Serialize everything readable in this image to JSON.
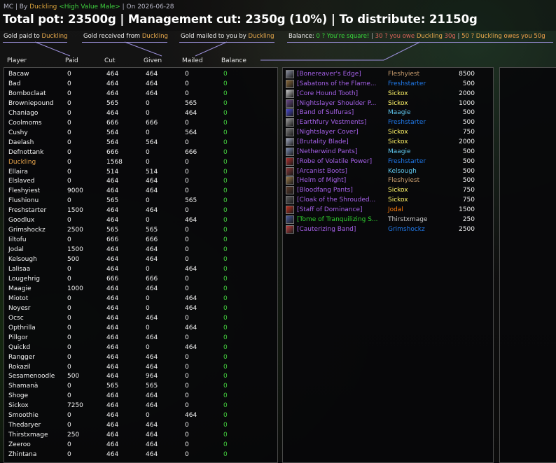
{
  "colors": {
    "gold": "#e3a24b",
    "green": "#45d43f",
    "epic_purple": "#a560e8",
    "uncommon_green": "#2fd02f",
    "legend_line": "#9a8fd8",
    "class_warrior": "#c69b6d",
    "class_shaman": "#1f78e8",
    "class_rogue": "#fff468",
    "class_mage": "#5fc7ee",
    "class_druid": "#ff7d0a"
  },
  "header": {
    "sub_prefix": "MC | By ",
    "sub_author": "Duckling",
    "sub_guild": "<High Value Male>",
    "sub_date": " | On 2026-06-28",
    "title": "Total pot: 23500g | Management cut: 2350g (10%) | To distribute: 21150g"
  },
  "legend": {
    "paid_label": "Gold paid to ",
    "paid_name": "Duckling",
    "received_label": "Gold received from ",
    "received_name": "Duckling",
    "mailed_label": "Gold mailed to you by ",
    "mailed_name": "Duckling",
    "balance_label": "Balance: ",
    "square": "0 ? You're square!",
    "sep1": " | ",
    "owe_prefix": "30 ? you owe ",
    "owe_name": "Duckling",
    "owe_suffix": " 30g",
    "sep2": " | ",
    "owed_prefix": "50 ? ",
    "owed_name": "Duckling",
    "owed_suffix": " owes you 50g"
  },
  "columns": {
    "player": "Player",
    "paid": "Paid",
    "cut": "Cut",
    "given": "Given",
    "mailed": "Mailed",
    "balance": "Balance"
  },
  "players": [
    {
      "name": "Bacaw",
      "paid": "0",
      "cut": "464",
      "given": "464",
      "mailed": "0",
      "balance": "0"
    },
    {
      "name": "Bad",
      "paid": "0",
      "cut": "464",
      "given": "464",
      "mailed": "0",
      "balance": "0"
    },
    {
      "name": "Bomboclaat",
      "paid": "0",
      "cut": "464",
      "given": "464",
      "mailed": "0",
      "balance": "0"
    },
    {
      "name": "Browniepound",
      "paid": "0",
      "cut": "565",
      "given": "0",
      "mailed": "565",
      "balance": "0"
    },
    {
      "name": "Chaniago",
      "paid": "0",
      "cut": "464",
      "given": "0",
      "mailed": "464",
      "balance": "0"
    },
    {
      "name": "Coolmoms",
      "paid": "0",
      "cut": "666",
      "given": "666",
      "mailed": "0",
      "balance": "0"
    },
    {
      "name": "Cushy",
      "paid": "0",
      "cut": "564",
      "given": "0",
      "mailed": "564",
      "balance": "0"
    },
    {
      "name": "Daelash",
      "paid": "0",
      "cut": "564",
      "given": "564",
      "mailed": "0",
      "balance": "0"
    },
    {
      "name": "Defnottank",
      "paid": "0",
      "cut": "666",
      "given": "0",
      "mailed": "666",
      "balance": "0"
    },
    {
      "name": "Duckling",
      "paid": "0",
      "cut": "1568",
      "given": "0",
      "mailed": "0",
      "balance": "0",
      "self": true
    },
    {
      "name": "Ellaira",
      "paid": "0",
      "cut": "514",
      "given": "514",
      "mailed": "0",
      "balance": "0"
    },
    {
      "name": "Elslaved",
      "paid": "0",
      "cut": "464",
      "given": "464",
      "mailed": "0",
      "balance": "0"
    },
    {
      "name": "Fleshyiest",
      "paid": "9000",
      "cut": "464",
      "given": "464",
      "mailed": "0",
      "balance": "0"
    },
    {
      "name": "Flushionu",
      "paid": "0",
      "cut": "565",
      "given": "0",
      "mailed": "565",
      "balance": "0"
    },
    {
      "name": "Freshstarter",
      "paid": "1500",
      "cut": "464",
      "given": "464",
      "mailed": "0",
      "balance": "0"
    },
    {
      "name": "Goodlux",
      "paid": "0",
      "cut": "464",
      "given": "0",
      "mailed": "464",
      "balance": "0"
    },
    {
      "name": "Grimshockz",
      "paid": "2500",
      "cut": "565",
      "given": "565",
      "mailed": "0",
      "balance": "0"
    },
    {
      "name": "Iiltofu",
      "paid": "0",
      "cut": "666",
      "given": "666",
      "mailed": "0",
      "balance": "0"
    },
    {
      "name": "Jodal",
      "paid": "1500",
      "cut": "464",
      "given": "464",
      "mailed": "0",
      "balance": "0"
    },
    {
      "name": "Kelsough",
      "paid": "500",
      "cut": "464",
      "given": "464",
      "mailed": "0",
      "balance": "0"
    },
    {
      "name": "Lalisaa",
      "paid": "0",
      "cut": "464",
      "given": "0",
      "mailed": "464",
      "balance": "0"
    },
    {
      "name": "Lougehrig",
      "paid": "0",
      "cut": "666",
      "given": "666",
      "mailed": "0",
      "balance": "0"
    },
    {
      "name": "Maagie",
      "paid": "1000",
      "cut": "464",
      "given": "464",
      "mailed": "0",
      "balance": "0"
    },
    {
      "name": "Miotot",
      "paid": "0",
      "cut": "464",
      "given": "0",
      "mailed": "464",
      "balance": "0"
    },
    {
      "name": "Noyesr",
      "paid": "0",
      "cut": "464",
      "given": "0",
      "mailed": "464",
      "balance": "0"
    },
    {
      "name": "Ocsc",
      "paid": "0",
      "cut": "464",
      "given": "464",
      "mailed": "0",
      "balance": "0"
    },
    {
      "name": "Opthrilla",
      "paid": "0",
      "cut": "464",
      "given": "0",
      "mailed": "464",
      "balance": "0"
    },
    {
      "name": "Pillgor",
      "paid": "0",
      "cut": "464",
      "given": "464",
      "mailed": "0",
      "balance": "0"
    },
    {
      "name": "Quickd",
      "paid": "0",
      "cut": "464",
      "given": "0",
      "mailed": "464",
      "balance": "0"
    },
    {
      "name": "Rangger",
      "paid": "0",
      "cut": "464",
      "given": "464",
      "mailed": "0",
      "balance": "0"
    },
    {
      "name": "Rokazil",
      "paid": "0",
      "cut": "464",
      "given": "464",
      "mailed": "0",
      "balance": "0"
    },
    {
      "name": "Sesamenoodle",
      "paid": "500",
      "cut": "464",
      "given": "964",
      "mailed": "0",
      "balance": "0"
    },
    {
      "name": "Shamanà",
      "paid": "0",
      "cut": "565",
      "given": "565",
      "mailed": "0",
      "balance": "0"
    },
    {
      "name": "Shoge",
      "paid": "0",
      "cut": "464",
      "given": "464",
      "mailed": "0",
      "balance": "0"
    },
    {
      "name": "Sickox",
      "paid": "7250",
      "cut": "464",
      "given": "464",
      "mailed": "0",
      "balance": "0"
    },
    {
      "name": "Smoothie",
      "paid": "0",
      "cut": "464",
      "given": "0",
      "mailed": "464",
      "balance": "0"
    },
    {
      "name": "Thedaryer",
      "paid": "0",
      "cut": "464",
      "given": "464",
      "mailed": "0",
      "balance": "0"
    },
    {
      "name": "Thirstxmage",
      "paid": "250",
      "cut": "464",
      "given": "464",
      "mailed": "0",
      "balance": "0"
    },
    {
      "name": "Zeeroo",
      "paid": "0",
      "cut": "464",
      "given": "464",
      "mailed": "0",
      "balance": "0"
    },
    {
      "name": "Zhintana",
      "paid": "0",
      "cut": "464",
      "given": "464",
      "mailed": "0",
      "balance": "0"
    }
  ],
  "items": [
    {
      "name": "[Bonereaver's Edge]",
      "winner": "Fleshyiest",
      "winner_color": "#c69b6d",
      "price": "8500",
      "icon": "sword-icon",
      "icon_color": "#8a8fa0",
      "quality": "epic"
    },
    {
      "name": "[Sabatons of the Flame...",
      "winner": "Freshstarter",
      "winner_color": "#1f78e8",
      "price": "500",
      "icon": "boots-icon",
      "icon_color": "#8b6a3a",
      "quality": "epic"
    },
    {
      "name": "[Core Hound Tooth]",
      "winner": "Sickox",
      "winner_color": "#fff468",
      "price": "2000",
      "icon": "dagger-icon",
      "icon_color": "#c9c9c9",
      "quality": "epic"
    },
    {
      "name": "[Nightslayer Shoulder P...",
      "winner": "Sickox",
      "winner_color": "#fff468",
      "price": "1000",
      "icon": "shoulder-icon",
      "icon_color": "#6a4a8a",
      "quality": "epic"
    },
    {
      "name": "[Band of Sulfuras]",
      "winner": "Maagie",
      "winner_color": "#5fc7ee",
      "price": "500",
      "icon": "ring-icon",
      "icon_color": "#4a4ad0",
      "quality": "epic"
    },
    {
      "name": "[Earthfury Vestments]",
      "winner": "Freshstarter",
      "winner_color": "#1f78e8",
      "price": "500",
      "icon": "chest-icon",
      "icon_color": "#9a9a9a",
      "quality": "epic"
    },
    {
      "name": "[Nightslayer Cover]",
      "winner": "Sickox",
      "winner_color": "#fff468",
      "price": "750",
      "icon": "helm-icon",
      "icon_color": "#7a7a7a",
      "quality": "epic"
    },
    {
      "name": "[Brutality Blade]",
      "winner": "Sickox",
      "winner_color": "#fff468",
      "price": "2000",
      "icon": "sword-icon",
      "icon_color": "#a0a8c0",
      "quality": "epic"
    },
    {
      "name": "[Netherwind Pants]",
      "winner": "Maagie",
      "winner_color": "#5fc7ee",
      "price": "500",
      "icon": "pants-icon",
      "icon_color": "#7a8ab0",
      "quality": "epic"
    },
    {
      "name": "[Robe of Volatile Power]",
      "winner": "Freshstarter",
      "winner_color": "#1f78e8",
      "price": "500",
      "icon": "robe-icon",
      "icon_color": "#b03030",
      "quality": "epic"
    },
    {
      "name": "[Arcanist Boots]",
      "winner": "Kelsough",
      "winner_color": "#5fc7ee",
      "price": "500",
      "icon": "boots-icon",
      "icon_color": "#8a3a3a",
      "quality": "epic"
    },
    {
      "name": "[Helm of Might]",
      "winner": "Fleshyiest",
      "winner_color": "#c69b6d",
      "price": "500",
      "icon": "helm-icon",
      "icon_color": "#9a7a4a",
      "quality": "epic"
    },
    {
      "name": "[Bloodfang Pants]",
      "winner": "Sickox",
      "winner_color": "#fff468",
      "price": "750",
      "icon": "pants-icon",
      "icon_color": "#5a3a2a",
      "quality": "epic"
    },
    {
      "name": "[Cloak of the Shrouded...",
      "winner": "Sickox",
      "winner_color": "#fff468",
      "price": "750",
      "icon": "cloak-icon",
      "icon_color": "#5a5a5a",
      "quality": "epic"
    },
    {
      "name": "[Staff of Dominance]",
      "winner": "Jodal",
      "winner_color": "#ff7d0a",
      "price": "1500",
      "icon": "staff-icon",
      "icon_color": "#c03020",
      "quality": "epic"
    },
    {
      "name": "[Tome of Tranquilizing S...",
      "winner": "Thirstxmage",
      "winner_color": "#c8c8c8",
      "price": "250",
      "icon": "book-icon",
      "icon_color": "#4a5a9a",
      "quality": "uncommon"
    },
    {
      "name": "[Cauterizing Band]",
      "winner": "Grimshockz",
      "winner_color": "#1f78e8",
      "price": "2500",
      "icon": "ring-icon",
      "icon_color": "#c04040",
      "quality": "epic"
    }
  ]
}
